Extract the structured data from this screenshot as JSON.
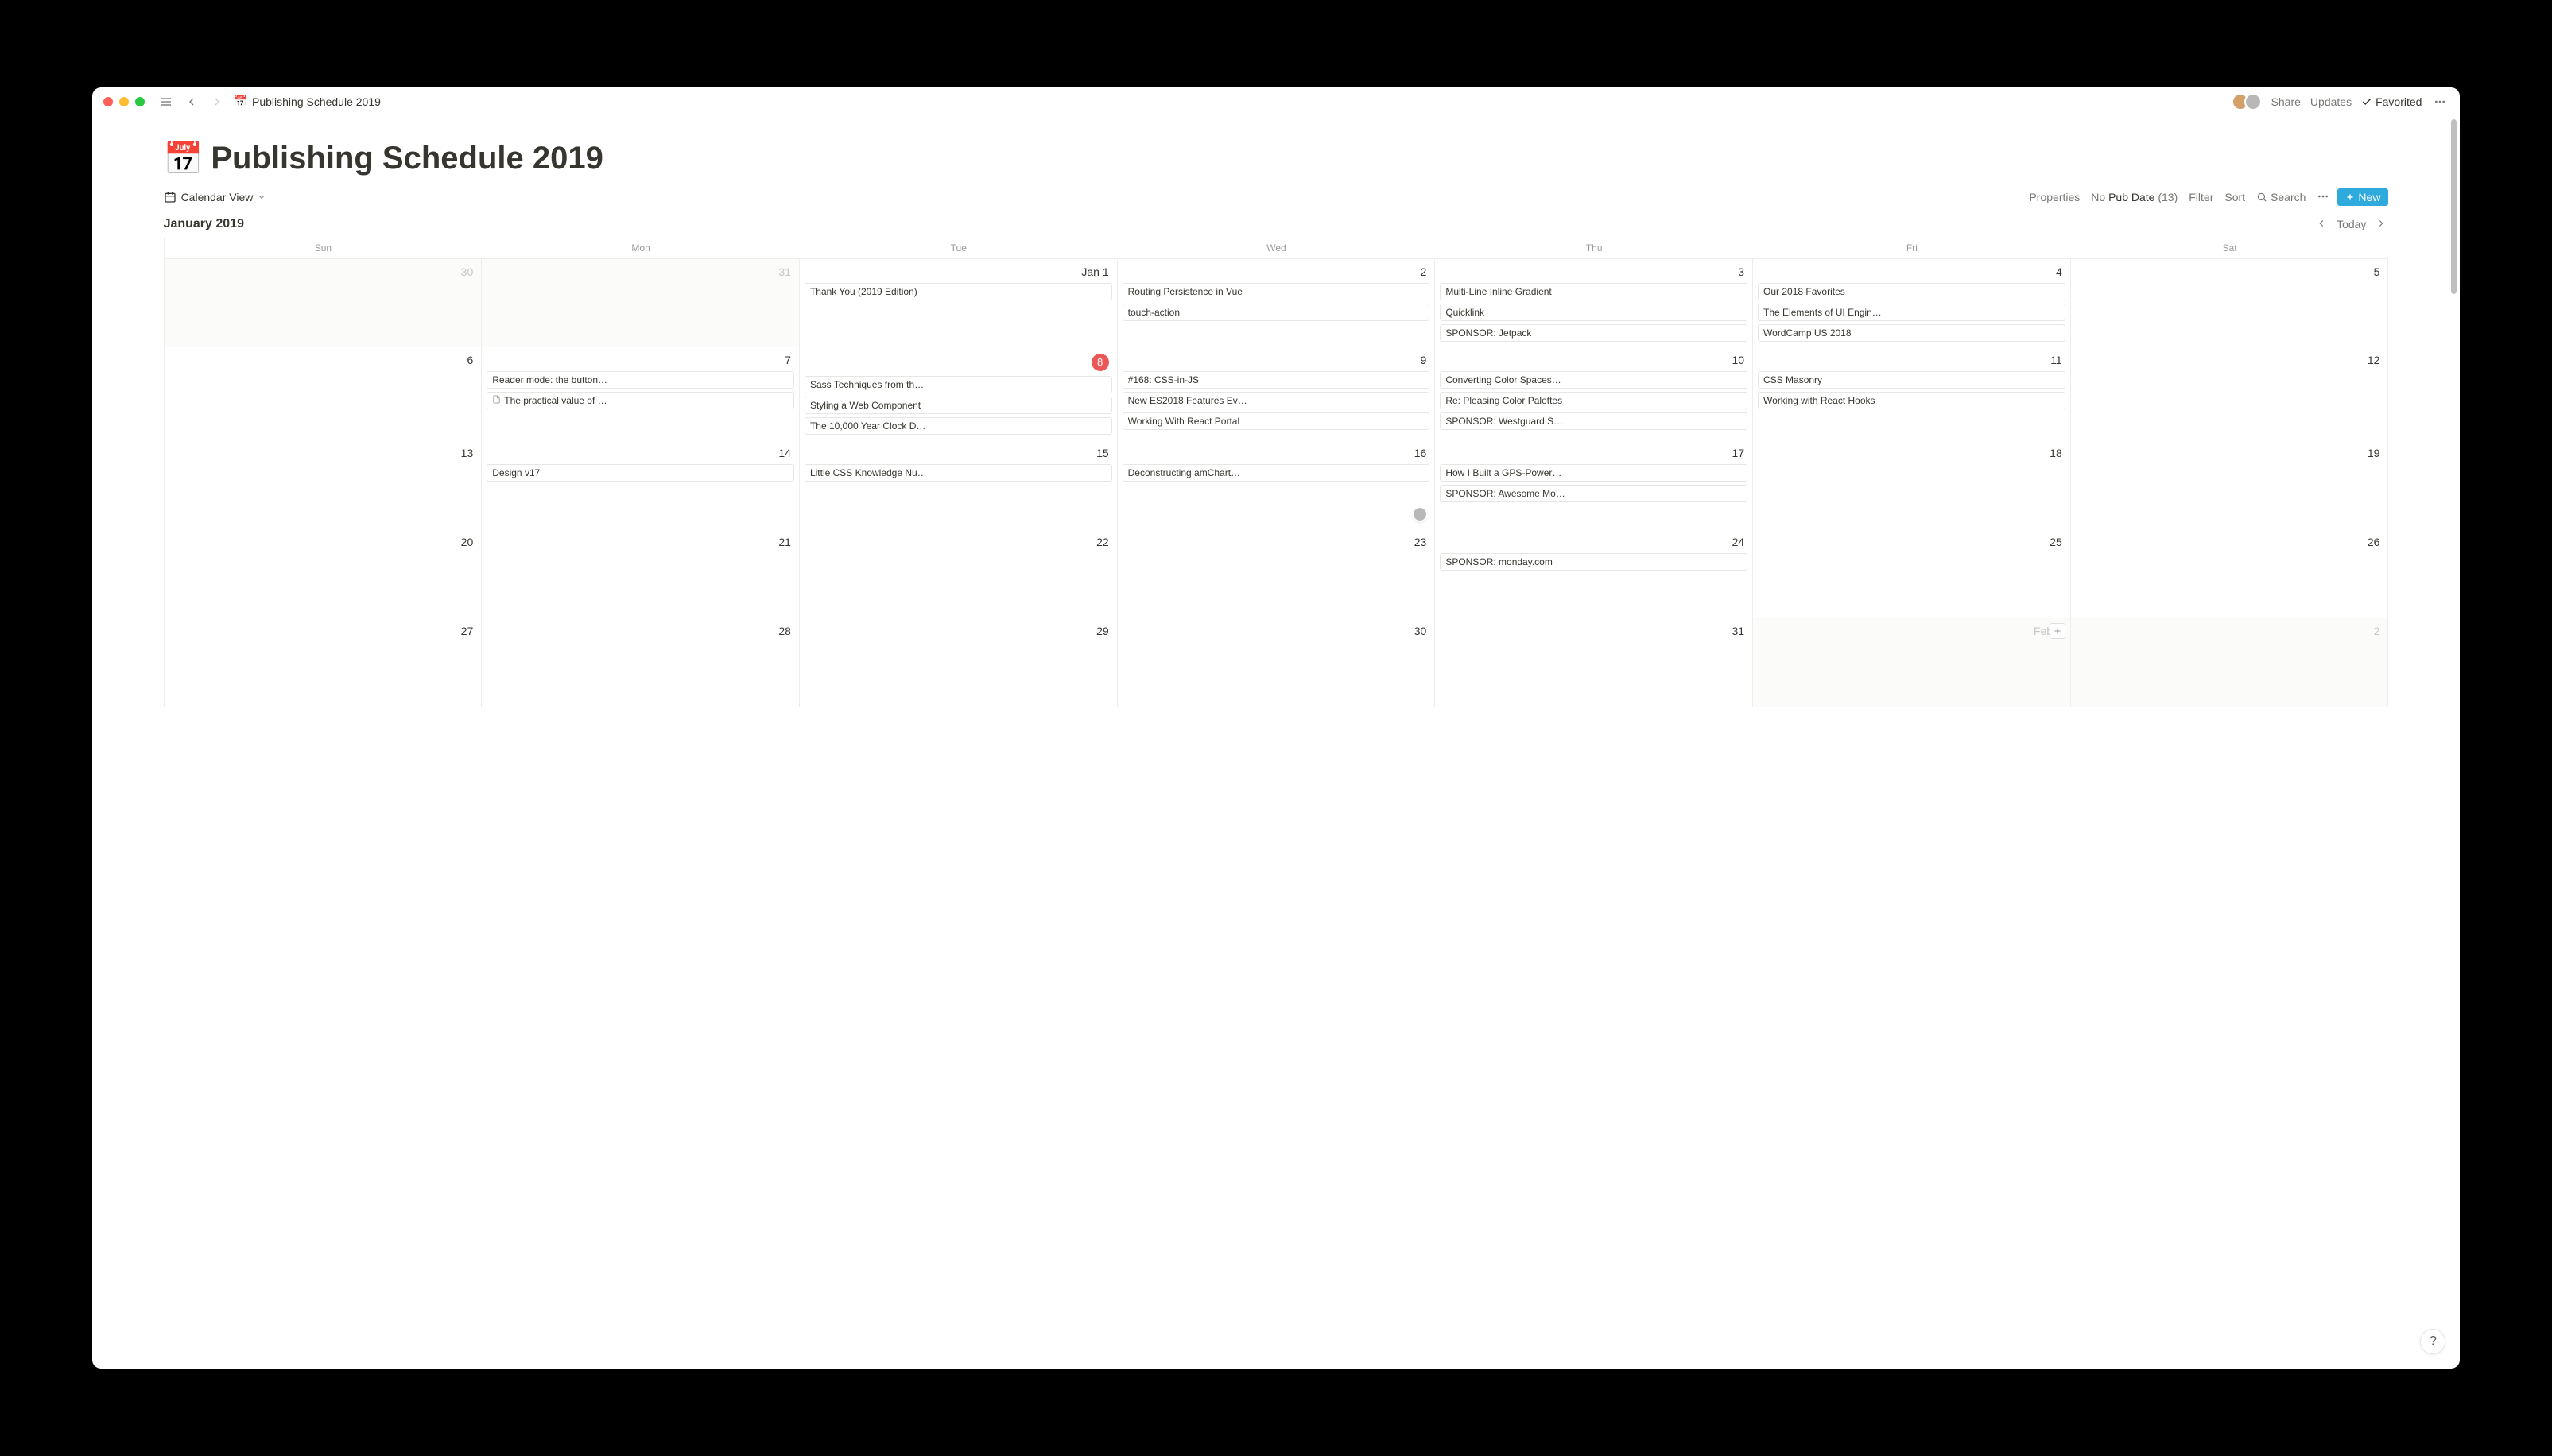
{
  "window": {
    "breadcrumb_icon": "📅",
    "breadcrumb": "Publishing Schedule 2019"
  },
  "titlebar": {
    "share": "Share",
    "updates": "Updates",
    "favorited": "Favorited"
  },
  "page": {
    "icon": "📅",
    "title": "Publishing Schedule 2019"
  },
  "view": {
    "name": "Calendar View",
    "properties": "Properties",
    "filter_prefix": "No ",
    "filter_field": "Pub Date",
    "filter_count": "(13)",
    "filter": "Filter",
    "sort": "Sort",
    "search": "Search",
    "new": "New"
  },
  "month": {
    "label": "January 2019",
    "today": "Today"
  },
  "dow": [
    "Sun",
    "Mon",
    "Tue",
    "Wed",
    "Thu",
    "Fri",
    "Sat"
  ],
  "weeks": [
    {
      "days": [
        {
          "num": "30",
          "out": true,
          "events": []
        },
        {
          "num": "31",
          "out": true,
          "events": []
        },
        {
          "num": "Jan 1",
          "label": true,
          "events": [
            {
              "t": "Thank You (2019 Edition)"
            }
          ]
        },
        {
          "num": "2",
          "events": [
            {
              "t": "Routing Persistence in Vue"
            },
            {
              "t": "touch-action"
            }
          ]
        },
        {
          "num": "3",
          "events": [
            {
              "t": "Multi-Line Inline Gradient"
            },
            {
              "t": "Quicklink"
            },
            {
              "t": "SPONSOR: Jetpack"
            }
          ]
        },
        {
          "num": "4",
          "events": [
            {
              "t": "Our 2018 Favorites"
            },
            {
              "t": "The Elements of UI Engin…"
            },
            {
              "t": "WordCamp US 2018"
            }
          ]
        },
        {
          "num": "5",
          "events": []
        }
      ]
    },
    {
      "days": [
        {
          "num": "6",
          "events": []
        },
        {
          "num": "7",
          "events": [
            {
              "t": "Reader mode: the button…"
            },
            {
              "t": "The practical value of …",
              "doc": true
            }
          ]
        },
        {
          "num": "8",
          "today": true,
          "events": [
            {
              "t": "Sass Techniques from th…"
            },
            {
              "t": "Styling a Web Component"
            },
            {
              "t": "The 10,000 Year Clock D…"
            }
          ]
        },
        {
          "num": "9",
          "events": [
            {
              "t": "#168: CSS-in-JS"
            },
            {
              "t": "New ES2018 Features Ev…"
            },
            {
              "t": "Working With React Portal"
            }
          ]
        },
        {
          "num": "10",
          "events": [
            {
              "t": "Converting Color Spaces…"
            },
            {
              "t": "Re: Pleasing Color Palettes"
            },
            {
              "t": "SPONSOR: Westguard S…"
            }
          ]
        },
        {
          "num": "11",
          "events": [
            {
              "t": "CSS Masonry"
            },
            {
              "t": "Working with React Hooks"
            }
          ]
        },
        {
          "num": "12",
          "events": []
        }
      ]
    },
    {
      "days": [
        {
          "num": "13",
          "events": []
        },
        {
          "num": "14",
          "events": [
            {
              "t": "Design v17"
            }
          ]
        },
        {
          "num": "15",
          "events": [
            {
              "t": "Little CSS Knowledge Nu…"
            }
          ]
        },
        {
          "num": "16",
          "events": [
            {
              "t": "Deconstructing amChart…"
            }
          ],
          "avatar": true
        },
        {
          "num": "17",
          "events": [
            {
              "t": "How I Built a GPS-Power…"
            },
            {
              "t": "SPONSOR: Awesome Mo…"
            }
          ]
        },
        {
          "num": "18",
          "events": []
        },
        {
          "num": "19",
          "events": []
        }
      ]
    },
    {
      "days": [
        {
          "num": "20",
          "events": []
        },
        {
          "num": "21",
          "events": []
        },
        {
          "num": "22",
          "events": []
        },
        {
          "num": "23",
          "events": []
        },
        {
          "num": "24",
          "events": [
            {
              "t": "SPONSOR: monday.com"
            }
          ]
        },
        {
          "num": "25",
          "events": []
        },
        {
          "num": "26",
          "events": []
        }
      ]
    },
    {
      "days": [
        {
          "num": "27",
          "events": []
        },
        {
          "num": "28",
          "events": []
        },
        {
          "num": "29",
          "events": []
        },
        {
          "num": "30",
          "events": []
        },
        {
          "num": "31",
          "events": []
        },
        {
          "num": "Feb 1",
          "out": true,
          "label": true,
          "add": true,
          "events": []
        },
        {
          "num": "2",
          "out": true,
          "events": []
        }
      ]
    }
  ]
}
